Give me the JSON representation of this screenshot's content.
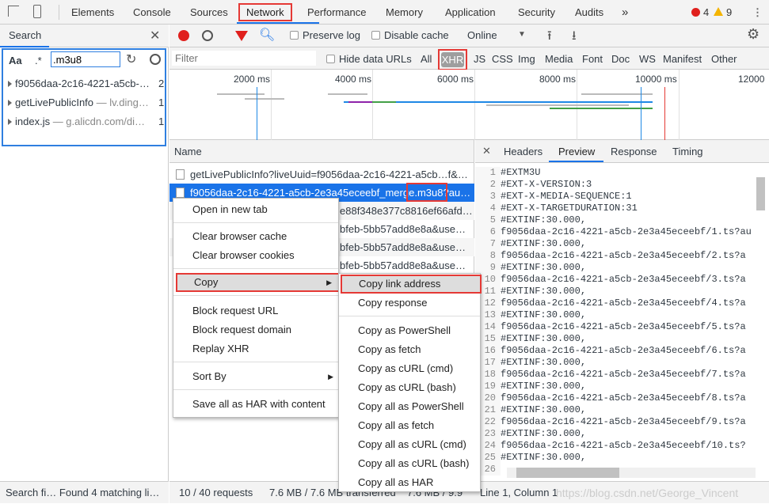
{
  "tabs": [
    "Elements",
    "Console",
    "Sources",
    "Network",
    "Performance",
    "Memory",
    "Application",
    "Security",
    "Audits"
  ],
  "more": "»",
  "errors": "4",
  "warnings": "9",
  "search": {
    "title": "Search",
    "case": "Aa",
    "regex": ".*",
    "query": ".m3u8",
    "results": [
      {
        "name": "f9056daa-2c16-4221-a5cb-…",
        "url": "",
        "count": "2"
      },
      {
        "name": "getLivePublicInfo",
        "url": " — lv.ding…",
        "count": "1"
      },
      {
        "name": "index.js",
        "url": " — g.alicdn.com/di…",
        "count": "1"
      }
    ],
    "status": "Search fi…  Found 4 matching li…"
  },
  "toolbar": {
    "preserve_log": "Preserve log",
    "disable_cache": "Disable cache",
    "throttle": "Online"
  },
  "filter": {
    "placeholder": "Filter",
    "hide_data_urls": "Hide data URLs",
    "types": [
      "All",
      "XHR",
      "JS",
      "CSS",
      "Img",
      "Media",
      "Font",
      "Doc",
      "WS",
      "Manifest",
      "Other"
    ],
    "active": "XHR"
  },
  "timeline": {
    "ticks": [
      "2000 ms",
      "4000 ms",
      "6000 ms",
      "8000 ms",
      "10000 ms",
      "12000"
    ]
  },
  "requests": {
    "header": "Name",
    "rows": [
      "getLivePublicInfo?liveUuid=f9056daa-2c16-4221-a5cb…f&…",
      "f9056daa-2c16-4221-a5cb-2e3a45eceebf_merge.m3u8?au…",
      "e88f348e377c8816ef66afd…",
      "bfeb-5bb57add8e8a&use…",
      "bfeb-5bb57add8e8a&use…",
      "bfeb-5bb57add8e8a&use…"
    ],
    "highlight": ".m3u8?"
  },
  "detail_tabs": [
    "Headers",
    "Preview",
    "Response",
    "Timing"
  ],
  "detail_active": "Preview",
  "preview": [
    "#EXTM3U",
    "#EXT-X-VERSION:3",
    "#EXT-X-MEDIA-SEQUENCE:1",
    "#EXT-X-TARGETDURATION:31",
    "#EXTINF:30.000,",
    "f9056daa-2c16-4221-a5cb-2e3a45eceebf/1.ts?au",
    "#EXTINF:30.000,",
    "f9056daa-2c16-4221-a5cb-2e3a45eceebf/2.ts?a",
    "#EXTINF:30.000,",
    "f9056daa-2c16-4221-a5cb-2e3a45eceebf/3.ts?a",
    "#EXTINF:30.000,",
    "f9056daa-2c16-4221-a5cb-2e3a45eceebf/4.ts?a",
    "#EXTINF:30.000,",
    "f9056daa-2c16-4221-a5cb-2e3a45eceebf/5.ts?a",
    "#EXTINF:30.000,",
    "f9056daa-2c16-4221-a5cb-2e3a45eceebf/6.ts?a",
    "#EXTINF:30.000,",
    "f9056daa-2c16-4221-a5cb-2e3a45eceebf/7.ts?a",
    "#EXTINF:30.000,",
    "f9056daa-2c16-4221-a5cb-2e3a45eceebf/8.ts?a",
    "#EXTINF:30.000,",
    "f9056daa-2c16-4221-a5cb-2e3a45eceebf/9.ts?a",
    "#EXTINF:30.000,",
    "f9056daa-2c16-4221-a5cb-2e3a45eceebf/10.ts?",
    "#EXTINF:30.000,",
    ""
  ],
  "status": {
    "requests": "10 / 40 requests",
    "transferred": "7.6 MB / 7.6 MB transferred",
    "resources": "7.6 MB / 9.9",
    "position": "Line 1, Column 1"
  },
  "context_menu": {
    "items": [
      "Open in new tab",
      "Clear browser cache",
      "Clear browser cookies",
      "Copy",
      "Block request URL",
      "Block request domain",
      "Replay XHR",
      "Sort By",
      "Save all as HAR with content"
    ]
  },
  "copy_menu": {
    "items": [
      "Copy link address",
      "Copy response",
      "Copy as PowerShell",
      "Copy as fetch",
      "Copy as cURL (cmd)",
      "Copy as cURL (bash)",
      "Copy all as PowerShell",
      "Copy all as fetch",
      "Copy all as cURL (cmd)",
      "Copy all as cURL (bash)",
      "Copy all as HAR"
    ]
  },
  "watermark": "https://blog.csdn.net/George_Vincent",
  "colors": {
    "accent": "#1a73e8",
    "highlight_box": "#e53935",
    "record": "#e0201d"
  }
}
